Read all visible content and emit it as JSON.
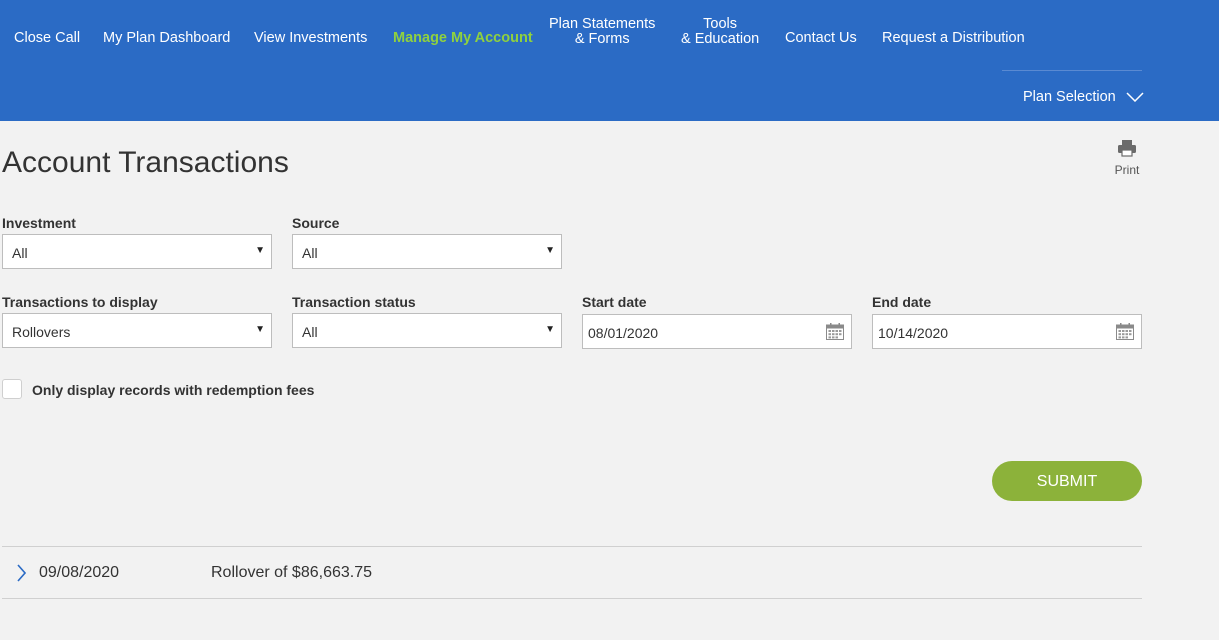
{
  "nav": {
    "close_call": "Close Call",
    "dashboard": "My Plan Dashboard",
    "investments": "View Investments",
    "manage_account": "Manage My Account",
    "statements_line1": "Plan Statements",
    "statements_line2": "& Forms",
    "tools_line1": "Tools",
    "tools_line2": "& Education",
    "contact": "Contact Us",
    "distribution": "Request a Distribution",
    "plan_selection": "Plan Selection",
    "active_color": "#8fd13f",
    "bar_color": "#2b6bc5"
  },
  "page": {
    "title": "Account Transactions",
    "print_label": "Print"
  },
  "filters": {
    "investment_label": "Investment",
    "investment_value": "All",
    "source_label": "Source",
    "source_value": "All",
    "transactions_label": "Transactions to display",
    "transactions_value": "Rollovers",
    "status_label": "Transaction status",
    "status_value": "All",
    "start_label": "Start date",
    "start_value": "08/01/2020",
    "end_label": "End date",
    "end_value": "10/14/2020",
    "redemption_label": "Only display records with redemption fees",
    "redemption_checked": false,
    "submit_label": "SUBMIT",
    "submit_color": "#8cb23a"
  },
  "transactions": [
    {
      "date": "09/08/2020",
      "description": "Rollover of $86,663.75"
    }
  ]
}
